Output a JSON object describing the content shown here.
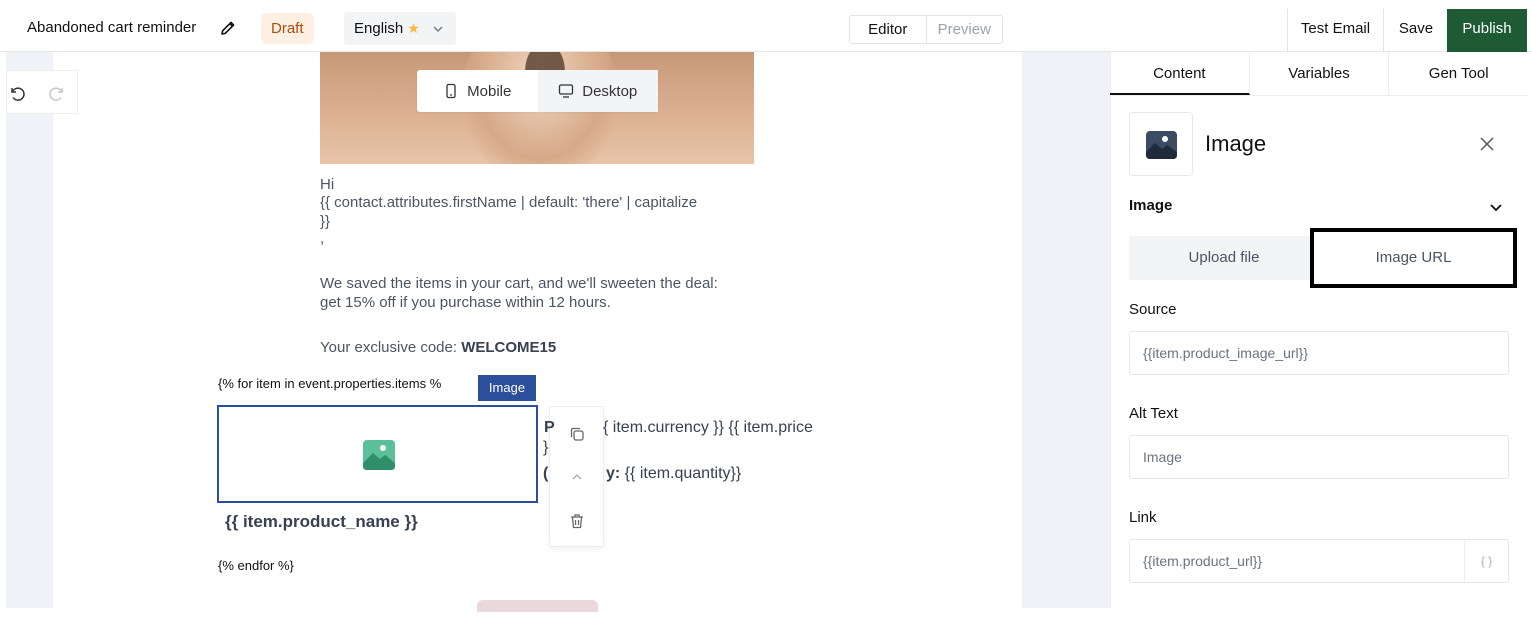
{
  "header": {
    "title": "Abandoned cart reminder",
    "status": "Draft",
    "language": "English",
    "view_tabs": [
      "Editor",
      "Preview"
    ],
    "test_email": "Test Email",
    "save": "Save",
    "publish": "Publish"
  },
  "canvas": {
    "device_toggle": [
      "Mobile",
      "Desktop"
    ],
    "greeting": "Hi",
    "name_tag": "{{ contact.attributes.firstName | default: 'there' | capitalize",
    "name_tag_close": "}}",
    "comma": ",",
    "body_line1": "We saved the items in your cart, and we'll sweeten the deal:",
    "body_line2": "get 15% off if you purchase within 12 hours.",
    "code_prefix": "Your exclusive code: ",
    "code": "WELCOME15",
    "loop_start": "{% for item in event.properties.items %",
    "selected_tag": "Image",
    "price_prefix": "P",
    "price_line": "{ item.currency }}  {{ item.price",
    "price_close": "}",
    "qty_prefix": "(",
    "qty_line": "y: {{ item.quantity}}",
    "product_name": "{{ item.product_name }}",
    "loop_end": "{% endfor %}"
  },
  "panel": {
    "tabs": [
      "Content",
      "Variables",
      "Gen Tool"
    ],
    "block_title": "Image",
    "section": "Image",
    "source_tabs": [
      "Upload file",
      "Image URL"
    ],
    "source_label": "Source",
    "source_value": "{{item.product_image_url}}",
    "alt_label": "Alt Text",
    "alt_value": "Image",
    "link_label": "Link",
    "link_value": "{{item.product_url}}",
    "braces": "{ }"
  },
  "colors": {
    "publish": "#1e5b35",
    "selection": "#2b4f9b",
    "draft_bg": "#fdf0e2",
    "image_icon": "#5bbf9a"
  }
}
